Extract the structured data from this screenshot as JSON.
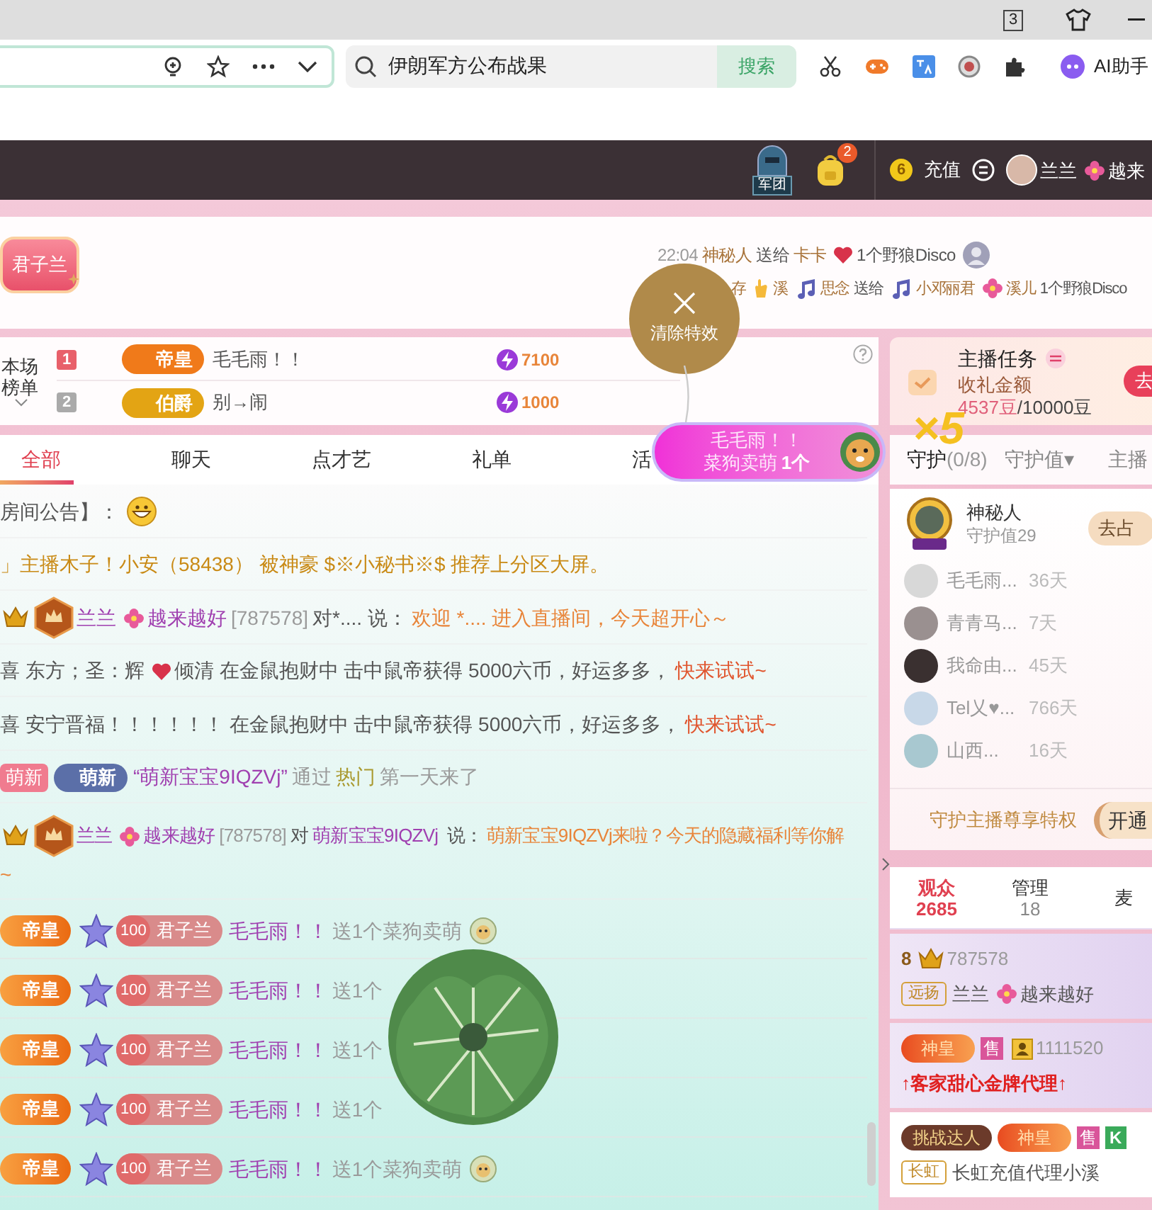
{
  "browser": {
    "tab_count": "3",
    "search": {
      "value": "伊朗军方公布战果",
      "button": "搜索"
    },
    "ai_label": "AI助手"
  },
  "header": {
    "legion_label": "军团",
    "bag_badge": "2",
    "coin": "6",
    "recharge": "充值",
    "user_name": [
      {
        "kind": "white",
        "text": "兰兰"
      },
      {
        "kind": "flower"
      },
      {
        "kind": "white",
        "text": "越来"
      }
    ]
  },
  "banner": {
    "badge": "君子兰",
    "gift_messages": [
      {
        "segments": [
          {
            "kind": "faint",
            "text": "22:04"
          },
          {
            "kind": "user",
            "text": "神秘人"
          },
          {
            "kind": "plain",
            "text": "送给"
          },
          {
            "kind": "user",
            "text": "卡卡"
          },
          {
            "kind": "heart"
          },
          {
            "kind": "plain",
            "text": "1个野狼Disco"
          },
          {
            "kind": "avatar"
          }
        ]
      },
      {
        "segments": [
          {
            "kind": "user",
            "text": "存"
          },
          {
            "kind": "hand"
          },
          {
            "kind": "user",
            "text": "溪"
          },
          {
            "kind": "music"
          },
          {
            "kind": "user",
            "text": "思念"
          },
          {
            "kind": "plain",
            "text": "送给"
          },
          {
            "kind": "music"
          },
          {
            "kind": "user",
            "text": "小邓丽君"
          },
          {
            "kind": "flower"
          },
          {
            "kind": "user",
            "text": "溪儿"
          },
          {
            "kind": "plain",
            "text": "1个野狼Disco"
          }
        ]
      }
    ]
  },
  "clear_effects": {
    "label": "清除特效"
  },
  "gift_popup": {
    "sender": "毛毛雨！！",
    "gift": "菜狗卖萌",
    "count": "1个",
    "multiplier": "×5"
  },
  "ranking": {
    "title": "本场榜单",
    "rows": [
      {
        "rank": "1",
        "title": "帝皇",
        "color": "#f07a1a",
        "name": "毛毛雨！！",
        "value": "7100"
      },
      {
        "rank": "2",
        "title": "伯爵",
        "color": "#e3a414",
        "name": "别→闹",
        "value": "1000"
      }
    ]
  },
  "task": {
    "title": "主播任务",
    "label": "收礼金额",
    "amount": "4537豆",
    "target": "/10000豆",
    "button": "去"
  },
  "chat_tabs": [
    {
      "label": "全部",
      "selected": true
    },
    {
      "label": "聊天",
      "selected": false
    },
    {
      "label": "点才艺",
      "selected": false
    },
    {
      "label": "礼单",
      "selected": false
    },
    {
      "label": "活",
      "selected": false
    }
  ],
  "chat": [
    {
      "kind": "line",
      "segments": [
        {
          "kind": "plain",
          "text": "房间公告】："
        },
        {
          "kind": "grin"
        }
      ]
    },
    {
      "kind": "line",
      "segments": [
        {
          "kind": "gold",
          "text": "」主播木子！小安（58438） 被神豪 $※小秘书※$ 推荐上分区大屏。"
        }
      ]
    },
    {
      "kind": "line",
      "segments": [
        {
          "kind": "crown"
        },
        {
          "kind": "hexbadge"
        },
        {
          "kind": "purple",
          "text": "兰兰"
        },
        {
          "kind": "flower"
        },
        {
          "kind": "purple",
          "text": "越来越好"
        },
        {
          "kind": "gray",
          "text": "[787578]"
        },
        {
          "kind": "plain",
          "text": "对*.... 说："
        },
        {
          "kind": "orange",
          "text": "欢迎 *.... 进入直播间，今天超开心～"
        }
      ]
    },
    {
      "kind": "line",
      "segments": [
        {
          "kind": "plain",
          "text": "喜 东方；圣：辉"
        },
        {
          "kind": "heart"
        },
        {
          "kind": "plain",
          "text": "倾清 在金鼠抱财中 击中鼠帝获得 5000六币，好运多多，"
        },
        {
          "kind": "link",
          "text": "快来试试~"
        }
      ]
    },
    {
      "kind": "line",
      "segments": [
        {
          "kind": "plain",
          "text": "喜 安宁晋福！！！！！！  在金鼠抱财中 击中鼠帝获得 5000六币，好运多多，"
        },
        {
          "kind": "link",
          "text": "快来试试~"
        }
      ]
    },
    {
      "kind": "line",
      "segments": [
        {
          "kind": "newbie-tag",
          "text": "萌新"
        },
        {
          "kind": "newbie-badge",
          "text": "萌新"
        },
        {
          "kind": "purple",
          "text": "“萌新宝宝9IQZVj”"
        },
        {
          "kind": "gray",
          "text": "通过"
        },
        {
          "kind": "green",
          "text": "热门"
        },
        {
          "kind": "gray",
          "text": "第一天来了"
        }
      ]
    },
    {
      "kind": "wrap",
      "segments": [
        {
          "kind": "crown"
        },
        {
          "kind": "hexbadge"
        },
        {
          "kind": "purple",
          "text": "兰兰"
        },
        {
          "kind": "flower"
        },
        {
          "kind": "purple",
          "text": "越来越好"
        },
        {
          "kind": "gray",
          "text": "[787578]"
        },
        {
          "kind": "plain",
          "text": "对"
        },
        {
          "kind": "purple",
          "text": "萌新宝宝9IQZVj"
        },
        {
          "kind": "plain",
          "text": " 说："
        },
        {
          "kind": "orange",
          "text": "萌新宝宝9IQZVj来啦？今天的隐藏福利等你解"
        }
      ]
    },
    {
      "kind": "tail",
      "segments": [
        {
          "kind": "orange",
          "text": "~"
        }
      ]
    },
    {
      "kind": "gift",
      "segments": [
        {
          "kind": "title-badge",
          "text": "帝皇"
        },
        {
          "kind": "star"
        },
        {
          "kind": "fan-badge",
          "number": "100",
          "text": "君子兰"
        },
        {
          "kind": "purple",
          "text": "毛毛雨！！"
        },
        {
          "kind": "gray",
          "text": "送1个菜狗卖萌"
        },
        {
          "kind": "dog"
        }
      ]
    },
    {
      "kind": "gift",
      "segments": [
        {
          "kind": "title-badge",
          "text": "帝皇"
        },
        {
          "kind": "star"
        },
        {
          "kind": "fan-badge",
          "number": "100",
          "text": "君子兰"
        },
        {
          "kind": "purple",
          "text": "毛毛雨！！"
        },
        {
          "kind": "gray",
          "text": "送1个"
        }
      ]
    },
    {
      "kind": "gift",
      "segments": [
        {
          "kind": "title-badge",
          "text": "帝皇"
        },
        {
          "kind": "star"
        },
        {
          "kind": "fan-badge",
          "number": "100",
          "text": "君子兰"
        },
        {
          "kind": "purple",
          "text": "毛毛雨！！"
        },
        {
          "kind": "gray",
          "text": "送1个"
        }
      ]
    },
    {
      "kind": "gift",
      "segments": [
        {
          "kind": "title-badge",
          "text": "帝皇"
        },
        {
          "kind": "star"
        },
        {
          "kind": "fan-badge",
          "number": "100",
          "text": "君子兰"
        },
        {
          "kind": "purple",
          "text": "毛毛雨！！"
        },
        {
          "kind": "gray",
          "text": "送1个"
        }
      ]
    },
    {
      "kind": "gift",
      "segments": [
        {
          "kind": "title-badge",
          "text": "帝皇"
        },
        {
          "kind": "star"
        },
        {
          "kind": "fan-badge",
          "number": "100",
          "text": "君子兰"
        },
        {
          "kind": "purple",
          "text": "毛毛雨！！"
        },
        {
          "kind": "gray",
          "text": "送1个菜狗卖萌"
        },
        {
          "kind": "dog"
        }
      ]
    }
  ],
  "guard_tabs": [
    {
      "label": "守护",
      "count": "(0/8)",
      "selected": true
    },
    {
      "label": "守护值▾",
      "selected": false
    },
    {
      "label": "主播",
      "selected": false
    }
  ],
  "guard": {
    "top": {
      "name": "神秘人",
      "value": "守护值29",
      "button": "去占"
    },
    "members": [
      {
        "name": "毛毛雨...",
        "days": "36天"
      },
      {
        "name": "青青马...",
        "days": "7天"
      },
      {
        "name": "我命由...",
        "days": "45天"
      },
      {
        "name": "Tel乂♥...",
        "days": "766天"
      },
      {
        "name": "山西...",
        "days": "16天"
      }
    ],
    "privilege": "守护主播尊享特权",
    "button": "开通"
  },
  "audience_tabs": [
    {
      "label": "观众",
      "count": "2685",
      "selected": true
    },
    {
      "label": "管理",
      "count": "18",
      "selected": false
    },
    {
      "label": "麦",
      "selected": false
    }
  ],
  "audience": [
    {
      "highlighted": true,
      "lines": [
        [
          {
            "kind": "level-num",
            "text": "8"
          },
          {
            "kind": "crown"
          },
          {
            "kind": "gray",
            "text": "787578"
          }
        ],
        [
          {
            "kind": "tag",
            "text": "远扬"
          },
          {
            "kind": "plain",
            "text": "兰兰"
          },
          {
            "kind": "flower"
          },
          {
            "kind": "plain",
            "text": "越来越好"
          }
        ]
      ]
    },
    {
      "highlighted": true,
      "lines": [
        [
          {
            "kind": "title-badge2",
            "text": "神皇"
          },
          {
            "kind": "sale",
            "text": "售"
          },
          {
            "kind": "person"
          },
          {
            "kind": "gray",
            "text": "1111520"
          }
        ],
        [
          {
            "kind": "red-bold",
            "text": "↑客家甜心金牌代理↑"
          }
        ]
      ]
    },
    {
      "highlighted": false,
      "lines": [
        [
          {
            "kind": "achievement",
            "text": "挑战达人"
          },
          {
            "kind": "title-badge2",
            "text": "神皇"
          },
          {
            "kind": "sale",
            "text": "售"
          },
          {
            "kind": "k-tag",
            "text": "K"
          }
        ],
        [
          {
            "kind": "tag",
            "text": "长虹"
          },
          {
            "kind": "plain",
            "text": "长虹充值代理小溪"
          }
        ]
      ]
    }
  ]
}
